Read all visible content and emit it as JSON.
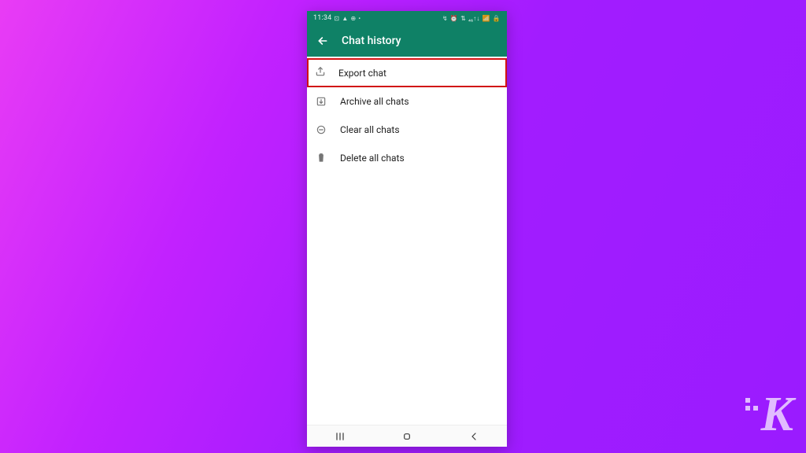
{
  "statusbar": {
    "time": "11:34",
    "left_icons": [
      "⊡",
      "▲",
      "⊕",
      "•"
    ],
    "right_icons": [
      "↯",
      "⏰",
      "⇅",
      "₄₆↑↓",
      "📶",
      "🔒"
    ]
  },
  "appbar": {
    "title": "Chat history"
  },
  "menu": {
    "items": [
      {
        "id": "export-chat",
        "label": "Export chat",
        "icon": "export-icon",
        "highlighted": true
      },
      {
        "id": "archive-all",
        "label": "Archive all chats",
        "icon": "archive-icon",
        "highlighted": false
      },
      {
        "id": "clear-all",
        "label": "Clear all chats",
        "icon": "clear-icon",
        "highlighted": false
      },
      {
        "id": "delete-all",
        "label": "Delete all chats",
        "icon": "delete-icon",
        "highlighted": false
      }
    ]
  },
  "watermark": {
    "text": "K"
  },
  "colors": {
    "brand_green": "#0f8166",
    "highlight_red": "#d11313"
  }
}
